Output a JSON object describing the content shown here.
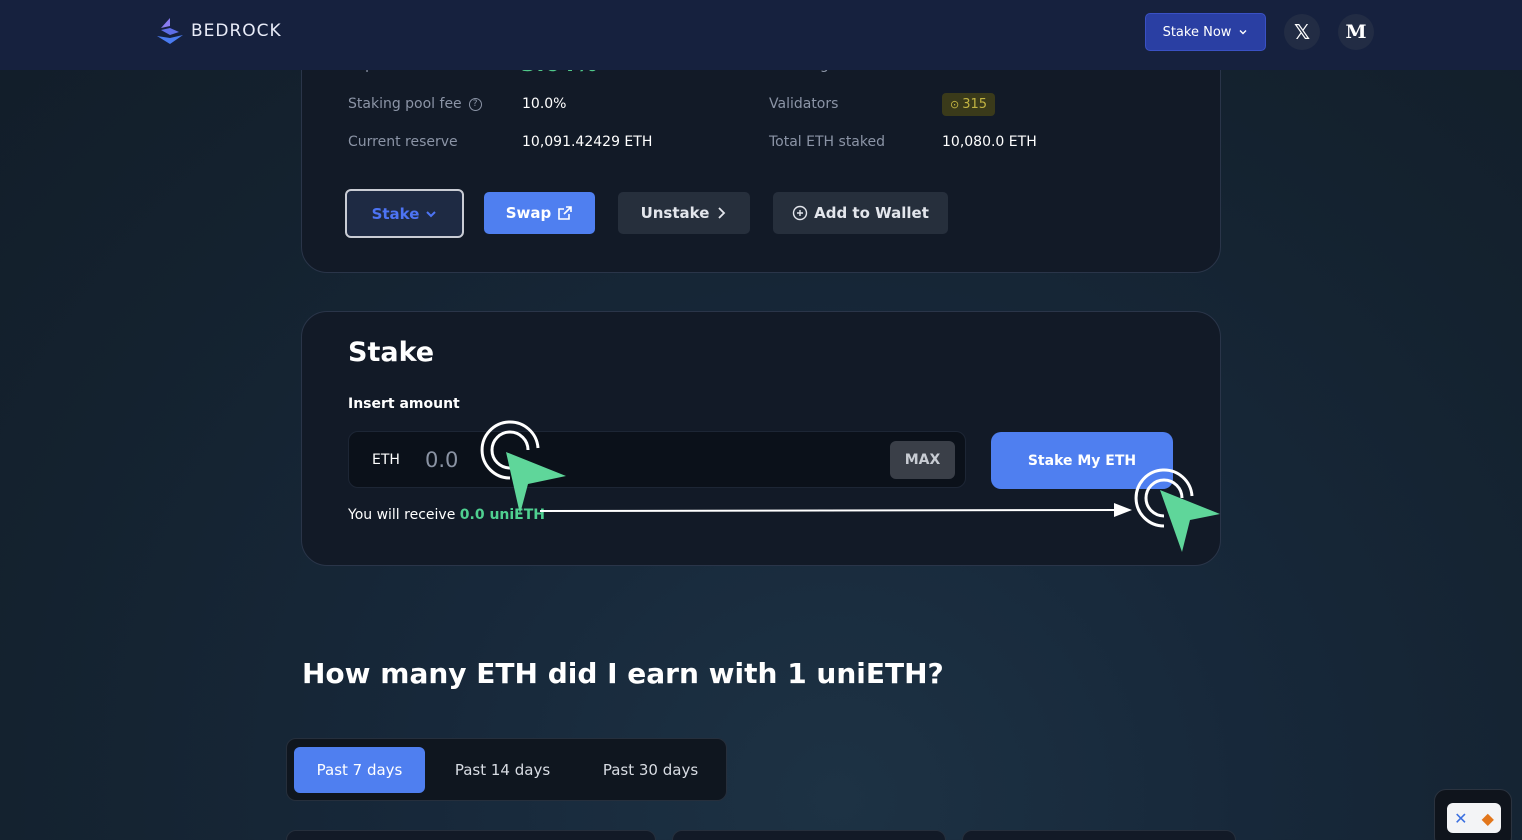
{
  "header": {
    "brand": "BEDROCK",
    "stake_now_label": "Stake Now",
    "social_x": "𝕏",
    "social_medium": "M"
  },
  "stats": {
    "pool_fee_label": "Staking pool fee",
    "pool_fee_value": "10.0%",
    "reserve_label": "Current reserve",
    "reserve_value": "10,091.42429 ETH",
    "validators_label": "Validators",
    "validators_value": "315",
    "total_staked_label": "Total ETH staked",
    "total_staked_value": "10,080.0 ETH"
  },
  "actions": {
    "stake": "Stake",
    "swap": "Swap",
    "unstake": "Unstake",
    "add_wallet": "Add to Wallet"
  },
  "stake_panel": {
    "title": "Stake",
    "insert_label": "Insert amount",
    "currency": "ETH",
    "amount_placeholder": "0.0",
    "max_label": "MAX",
    "submit_label": "Stake My ETH",
    "receive_prefix": "You will receive",
    "receive_value": "0.0 uniETH"
  },
  "earnings": {
    "title": "How many ETH did I earn with 1 uniETH?",
    "tabs": [
      "Past 7 days",
      "Past 14 days",
      "Past 30 days"
    ],
    "active_tab": "Past 7 days"
  },
  "colors": {
    "accent": "#4f7ff0",
    "green": "#4fd090",
    "header_bg": "#16213e"
  }
}
